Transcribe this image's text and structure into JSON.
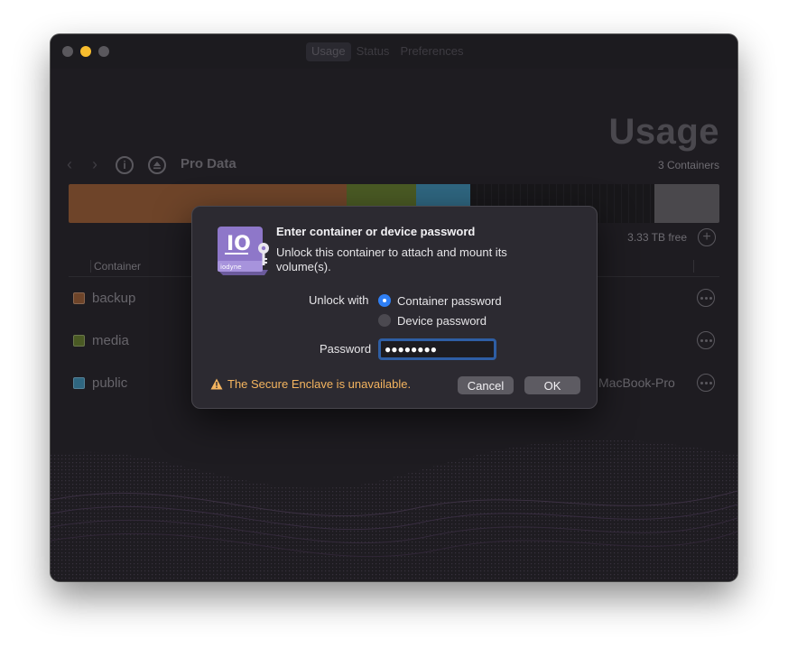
{
  "window": {
    "tabs": [
      "Usage",
      "Status",
      "Preferences"
    ],
    "active_tab": "Usage"
  },
  "header": {
    "title": "Usage",
    "subtitle": "3 Containers",
    "volume_name": "Pro Data"
  },
  "usage_bar": {
    "segments": [
      {
        "label": "backup",
        "fraction": 0.427,
        "color": "#6e4429"
      },
      {
        "label": "media",
        "fraction": 0.107,
        "color": "#4a5a24"
      },
      {
        "label": "public",
        "fraction": 0.083,
        "color": "#2f6680"
      },
      {
        "label": "free",
        "fraction": 0.283,
        "color": "#18171a"
      },
      {
        "label": "other",
        "fraction": 0.1,
        "color": "#4a484c"
      }
    ]
  },
  "free_space": "3.33 TB free",
  "table": {
    "column_container": "Container",
    "rows": [
      {
        "name": "backup",
        "color": "#6e4429",
        "host": ""
      },
      {
        "name": "media",
        "color": "#4a5a24",
        "host": ""
      },
      {
        "name": "public",
        "color": "#2f6680",
        "host": "MacBook-Pro"
      }
    ]
  },
  "dialog": {
    "title": "Enter container or device password",
    "body": "Unlock this container to attach and mount its volume(s).",
    "unlock_with_label": "Unlock with",
    "options": [
      "Container password",
      "Device password"
    ],
    "selected_option": "Container password",
    "password_label": "Password",
    "password_value": "●●●●●●●●",
    "warning": "The Secure Enclave is unavailable.",
    "cancel_label": "Cancel",
    "ok_label": "OK",
    "icon_text": "IO",
    "icon_brand": "iodyne"
  },
  "colors": {
    "accent": "#2f7ff4",
    "warning": "#f4b45f"
  }
}
